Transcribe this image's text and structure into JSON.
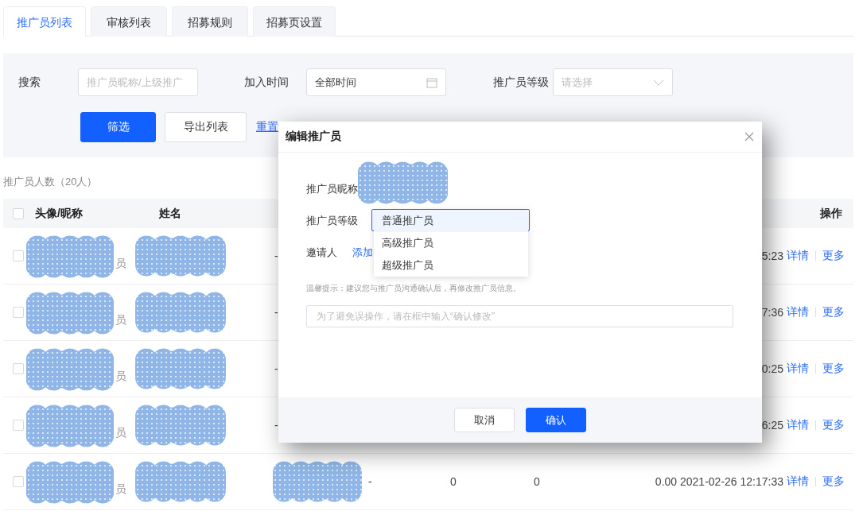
{
  "tabs": [
    {
      "label": "推广员列表",
      "selected": true
    },
    {
      "label": "审核列表",
      "selected": false
    },
    {
      "label": "招募规则",
      "selected": false
    },
    {
      "label": "招募页设置",
      "selected": false
    }
  ],
  "filters": {
    "search_label": "搜索",
    "search_placeholder": "推广员昵称/上级推广",
    "join_label": "加入时间",
    "join_value": "全部时间",
    "level_label": "推广员等级",
    "level_placeholder": "请选择",
    "filter_button": "筛选",
    "export_button": "导出列表",
    "reset_link": "重置"
  },
  "count_text": "推广员人数（20人）",
  "table": {
    "columns": [
      {
        "label": "头像/昵称"
      },
      {
        "label": "姓名"
      },
      {
        "label": "操作"
      }
    ],
    "header_checked": false,
    "rows": [
      {
        "checked": false,
        "nickname": {
          "redacted": true,
          "text": "员"
        },
        "name_redacted": true,
        "phone": {
          "redacted": false,
          "text": "-"
        },
        "time": "5:23",
        "actions": [
          "详情",
          "更多"
        ]
      },
      {
        "checked": false,
        "nickname": {
          "redacted": true,
          "text": "员"
        },
        "name_redacted": true,
        "phone": {
          "redacted": false,
          "text": "-"
        },
        "time": "7:36",
        "actions": [
          "详情",
          "更多"
        ]
      },
      {
        "checked": false,
        "nickname": {
          "redacted": true,
          "text": "员"
        },
        "name_redacted": true,
        "phone": {
          "redacted": false,
          "text": "-"
        },
        "time": "0:25",
        "actions": [
          "详情",
          "更多"
        ]
      },
      {
        "checked": false,
        "nickname": {
          "redacted": true,
          "text": "员"
        },
        "name_redacted": true,
        "phone": {
          "redacted": false,
          "text": "-"
        },
        "time": "6:25",
        "actions": [
          "详情",
          "更多"
        ]
      },
      {
        "checked": false,
        "nickname": {
          "redacted": true,
          "text": "员"
        },
        "name_redacted": true,
        "phone": {
          "redacted": true
        },
        "column_4": "-",
        "column_5": "0",
        "column_6": "0",
        "time": "0.00 2021-02-26 12:17:33",
        "actions": [
          "详情",
          "更多"
        ]
      }
    ]
  },
  "dialog": {
    "title": "编辑推广员",
    "nickname_label": "推广员昵称",
    "nickname_redacted": true,
    "level_label": "推广员等级",
    "level_options": [
      {
        "label": "普通推广员",
        "selected": true
      },
      {
        "label": "高级推广员",
        "selected": false
      },
      {
        "label": "超级推广员",
        "selected": false
      }
    ],
    "inviter_label": "邀请人",
    "inviter_link": "添加",
    "hint": "温馨提示：建议您与推广员沟通确认后，再修改推广员信息。",
    "confirm_placeholder": "为了避免误操作，请在框中输入“确认修改”",
    "buttons": [
      {
        "label": "取消",
        "kind": "secondary"
      },
      {
        "label": "确认",
        "kind": "primary"
      }
    ]
  }
}
